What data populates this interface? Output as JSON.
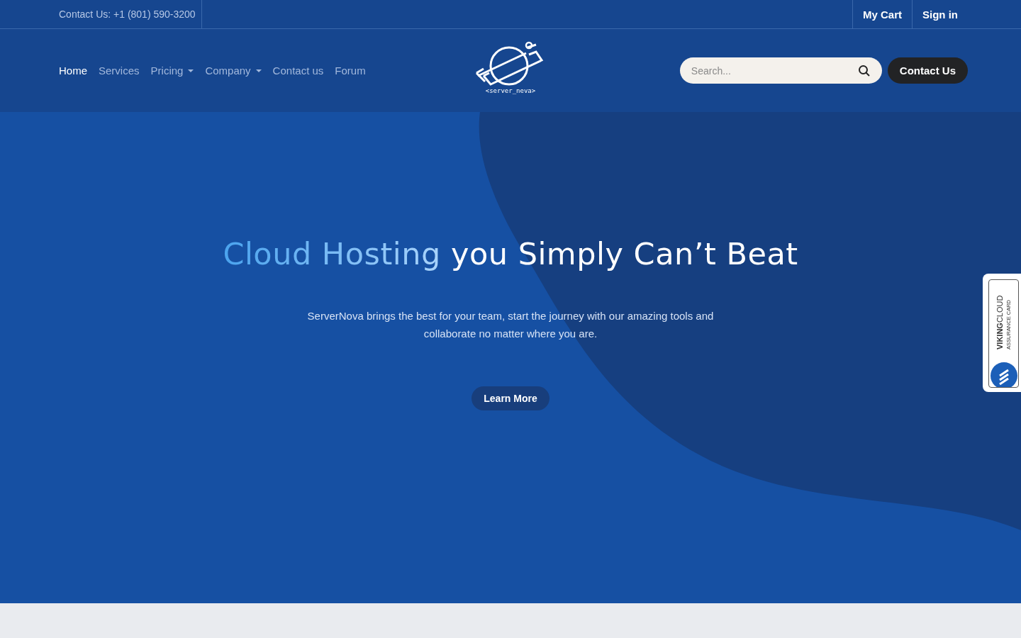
{
  "top_bar": {
    "contact": "Contact Us: +1 (801) 590-3200",
    "links": [
      "My Cart",
      "Sign in"
    ]
  },
  "nav": {
    "items": [
      {
        "label": "Home",
        "selected": true,
        "dropdown": false
      },
      {
        "label": "Services",
        "selected": false,
        "dropdown": false
      },
      {
        "label": "Pricing",
        "selected": false,
        "dropdown": true
      },
      {
        "label": "Company",
        "selected": false,
        "dropdown": true
      },
      {
        "label": "Contact us",
        "selected": false,
        "dropdown": false
      },
      {
        "label": "Forum",
        "selected": false,
        "dropdown": false
      }
    ],
    "logo_text": "<server_neva>",
    "search": {
      "placeholder": "Search..."
    },
    "contact_button": "Contact Us"
  },
  "hero": {
    "heading_highlight": "Cloud Hosting",
    "heading_rest": "you Simply Can’t Beat",
    "text": "ServerNova brings the best for your team, start the journey with our amazing tools and collaborate no matter where you are.",
    "button": "Learn More"
  },
  "badge": {
    "brand_bold": "VIKING",
    "brand_light": "CLOUD",
    "subtitle": "ASSURANCE CARD"
  }
}
